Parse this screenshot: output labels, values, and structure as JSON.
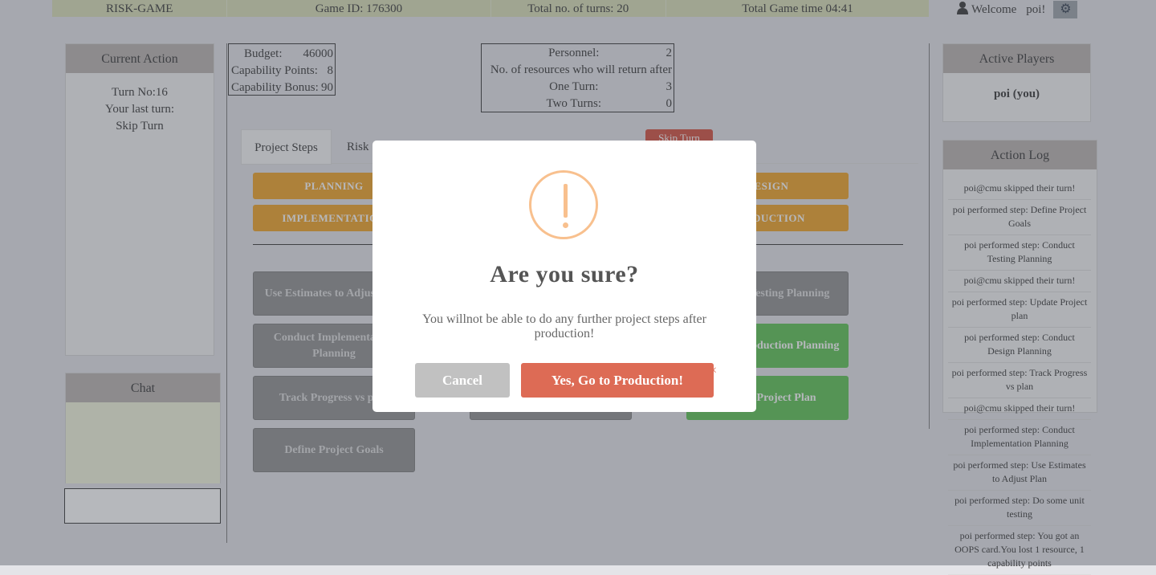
{
  "topbar": {
    "app_name": "RISK-GAME",
    "game_id": "Game ID: 176300",
    "total_turns": "Total no. of turns: 20",
    "total_time": "Total Game time 04:41"
  },
  "user": {
    "welcome": "Welcome",
    "name": "poi!",
    "user_icon": "user-icon",
    "settings_icon": "gear-icon"
  },
  "current_action": {
    "title": "Current Action",
    "turn_no": "Turn No:16",
    "last_turn_label": "Your last turn:",
    "last_turn_value": "Skip Turn"
  },
  "chat": {
    "title": "Chat",
    "input_value": ""
  },
  "budget": {
    "budget_label": "Budget:",
    "budget_value": "46000",
    "capability_points_label": "Capability Points:",
    "capability_points_value": "8",
    "capability_bonus_label": "Capability Bonus:",
    "capability_bonus_value": "90"
  },
  "personnel": {
    "personnel_label": "Personnel:",
    "personnel_value": "2",
    "return_label": "No. of resources who will return after",
    "one_turn_label": "One Turn:",
    "one_turn_value": "3",
    "two_turns_label": "Two Turns:",
    "two_turns_value": "0"
  },
  "tabs": [
    {
      "label": "Project Steps",
      "active": true
    },
    {
      "label": "Risk",
      "active": false
    }
  ],
  "skip_turn_label": "Skip Turn",
  "phases": [
    "PLANNING",
    "IMPLEMENTATION",
    "DESIGN",
    "PRODUCTION"
  ],
  "steps": [
    "Use Estimates to Adjust Plan",
    "Conduct Implementation Planning",
    "Track Progress vs plan",
    "Define Project Goals",
    "Conduct Testing Planning",
    "Conduct Production Planning",
    "Update Project Plan"
  ],
  "active_players": {
    "title": "Active Players",
    "player": "poi (you)"
  },
  "action_log": {
    "title": "Action Log",
    "entries": [
      "poi@cmu skipped their turn!",
      "poi performed step: Define Project Goals",
      "poi performed step: Conduct Testing Planning",
      "poi@cmu skipped their turn!",
      "poi performed step: Update Project plan",
      "poi performed step: Conduct Design Planning",
      "poi performed step: Track Progress vs plan",
      "poi@cmu skipped their turn!",
      "poi performed step: Conduct Implementation Planning",
      "poi performed step: Use Estimates to Adjust Plan",
      "poi performed step: Do some unit testing",
      "poi performed step: You got an OOPS card.You lost 1 resource, 1 capability points"
    ]
  },
  "modal": {
    "icon": "warning-icon",
    "title": "Are you  sure?",
    "text": "You willnot be able to do any further project steps after production!",
    "cancel_label": "Cancel",
    "confirm_label": "Yes, Go to Production!",
    "close_label": "×"
  },
  "colors": {
    "topbar": "#d9dfb6",
    "phase": "#f0a020",
    "step_done": "#8d8d8d",
    "step_available": "#58c24f",
    "danger": "#d24a3a",
    "confirm": "#dd6b55",
    "warning_icon": "#f8c08e"
  }
}
